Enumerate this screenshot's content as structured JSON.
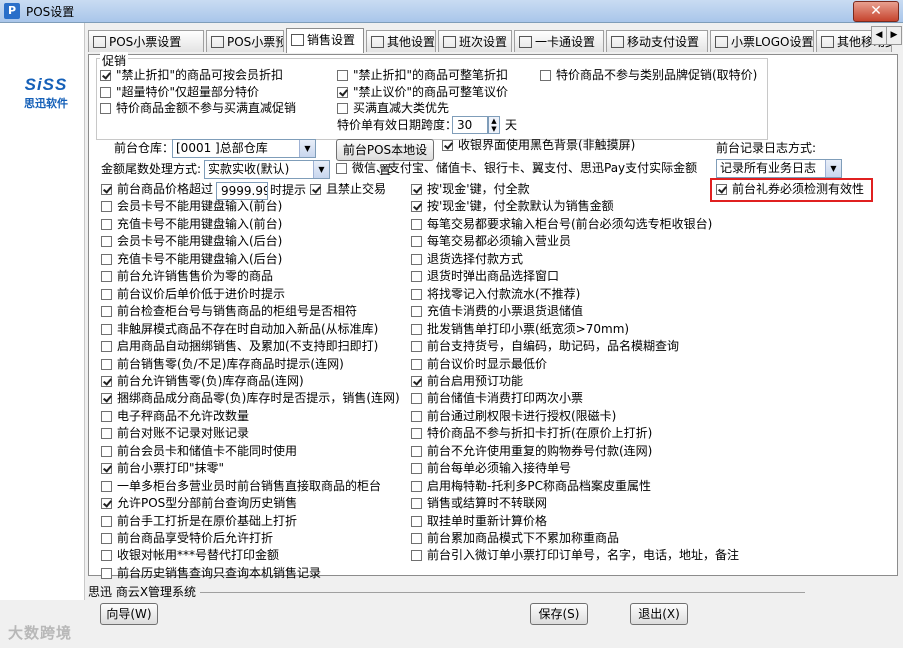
{
  "window": {
    "title": "POS设置",
    "close_label": "✕"
  },
  "logo": {
    "brand": "SiSS",
    "company": "思迅软件"
  },
  "tabs": [
    {
      "label": "POS小票设置",
      "icon": "receipt-icon"
    },
    {
      "label": "POS小票预览",
      "icon": "preview-icon"
    },
    {
      "label": "销售设置",
      "icon": "sales-icon",
      "active": true
    },
    {
      "label": "其他设置",
      "icon": "picture-icon"
    },
    {
      "label": "班次设置",
      "icon": "shift-icon"
    },
    {
      "label": "一卡通设置",
      "icon": "card-icon"
    },
    {
      "label": "移动支付设置",
      "icon": "mobile-pay-icon"
    },
    {
      "label": "小票LOGO设置",
      "icon": "logo-icon"
    },
    {
      "label": "其他移动支",
      "icon": "mobile-icon"
    }
  ],
  "promo": {
    "group_label": "促销",
    "items": [
      {
        "label": "\"禁止折扣\"的商品可按会员折扣",
        "checked": true
      },
      {
        "label": "\"超量特价\"仅超量部分特价",
        "checked": false
      },
      {
        "label": "特价商品金额不参与买满直减促销",
        "checked": false
      },
      {
        "label": "\"禁止折扣\"的商品可整笔折扣",
        "checked": false
      },
      {
        "label": "\"禁止议价\"的商品可整笔议价",
        "checked": true
      },
      {
        "label": "买满直减大类优先",
        "checked": false
      },
      {
        "label": "特价商品不参与类别品牌促销(取特价)",
        "checked": false
      }
    ],
    "days_label": "特价单有效日期跨度：",
    "days_value": "30",
    "days_unit": "天"
  },
  "settings": {
    "warehouse_label": "前台仓库：",
    "warehouse_value": "[0001  ]总部仓库",
    "pos_local_button": "前台POS本地设置",
    "black_bg": {
      "label": "收银界面使用黑色背景(非触摸屏)",
      "checked": true
    },
    "log_label": "前台记录日志方式:",
    "log_value": "记录所有业务日志",
    "rounding_label": "金额尾数处理方式:",
    "rounding_value": "实款实收(默认)",
    "pay_actual": {
      "label": "微信、支付宝、储值卡、银行卡、翼支付、思迅Pay支付实际金额",
      "checked": false
    },
    "gift_voucher": {
      "label": "前台礼券必须检测有效性",
      "checked": true
    },
    "price_limit_label": "前台商品价格超过",
    "price_limit_value": "9999.99",
    "price_limit_suffix": "时提示",
    "forbid_trade": {
      "label": "且禁止交易",
      "checked": true
    }
  },
  "left_column": [
    {
      "label": "前台商品价格超过",
      "checked": true
    },
    {
      "label": "会员卡号不能用键盘输入(前台)",
      "checked": false
    },
    {
      "label": "充值卡号不能用键盘输入(前台)",
      "checked": false
    },
    {
      "label": "会员卡号不能用键盘输入(后台)",
      "checked": false
    },
    {
      "label": "充值卡号不能用键盘输入(后台)",
      "checked": false
    },
    {
      "label": "前台允许销售售价为零的商品",
      "checked": false
    },
    {
      "label": "前台议价后单价低于进价时提示",
      "checked": false
    },
    {
      "label": "前台检查柜台号与销售商品的柜组号是否相符",
      "checked": false
    },
    {
      "label": "非触屏模式商品不存在时自动加入新品(从标准库)",
      "checked": false
    },
    {
      "label": "启用商品自动捆绑销售、及累加(不支持即扫即打)",
      "checked": false
    },
    {
      "label": "前台销售零(负/不足)库存商品时提示(连网)",
      "checked": false
    },
    {
      "label": "前台允许销售零(负)库存商品(连网)",
      "checked": true
    },
    {
      "label": "捆绑商品成分商品零(负)库存时是否提示，销售(连网)",
      "checked": true
    },
    {
      "label": "电子秤商品不允许改数量",
      "checked": false
    },
    {
      "label": "前台对账不记录对账记录",
      "checked": false
    },
    {
      "label": "前台会员卡和储值卡不能同时使用",
      "checked": false
    },
    {
      "label": "前台小票打印\"抹零\"",
      "checked": true
    },
    {
      "label": "一单多柜台多营业员时前台销售直接取商品的柜台",
      "checked": false
    },
    {
      "label": "允许POS型分部前台查询历史销售",
      "checked": true
    },
    {
      "label": "前台手工打折是在原价基础上打折",
      "checked": false
    },
    {
      "label": "前台商品享受特价后允许打折",
      "checked": false
    },
    {
      "label": "收银对帐用***号替代打印金额",
      "checked": false
    },
    {
      "label": "前台历史销售查询只查询本机销售记录",
      "checked": false
    }
  ],
  "right_column": [
    {
      "label": "按'现金'键，付全款",
      "checked": true
    },
    {
      "label": "按'现金'键，付全款默认为销售金额",
      "checked": true
    },
    {
      "label": "每笔交易都要求输入柜台号(前台必须勾选专柜收银台)",
      "checked": false
    },
    {
      "label": "每笔交易都必须输入营业员",
      "checked": false
    },
    {
      "label": "退货选择付款方式",
      "checked": false
    },
    {
      "label": "退货时弹出商品选择窗口",
      "checked": false
    },
    {
      "label": "将找零记入付款流水(不推荐)",
      "checked": false
    },
    {
      "label": "充值卡消费的小票退货退储值",
      "checked": false
    },
    {
      "label": "批发销售单打印小票(纸宽须>70mm)",
      "checked": false
    },
    {
      "label": "前台支持货号，自编码，助记码，品名模糊查询",
      "checked": false
    },
    {
      "label": "前台议价时显示最低价",
      "checked": false
    },
    {
      "label": "前台启用预订功能",
      "checked": true
    },
    {
      "label": "前台储值卡消费打印两次小票",
      "checked": false
    },
    {
      "label": "前台通过刷权限卡进行授权(限磁卡)",
      "checked": false
    },
    {
      "label": "特价商品不参与折扣卡打折(在原价上打折)",
      "checked": false
    },
    {
      "label": "前台不允许使用重复的购物券号付款(连网)",
      "checked": false
    },
    {
      "label": "前台每单必须输入接待单号",
      "checked": false
    },
    {
      "label": "启用梅特勒-托利多PC称商品档案皮重属性",
      "checked": false
    },
    {
      "label": "销售或结算时不转联网",
      "checked": false
    },
    {
      "label": "取挂单时重新计算价格",
      "checked": false
    },
    {
      "label": "前台累加商品模式下不累加称重商品",
      "checked": false
    },
    {
      "label": "前台引入微订单小票打印订单号，名字，电话，地址，备注",
      "checked": false
    }
  ],
  "footer": {
    "company_line": "思迅 商云X管理系统",
    "wizard_button": "向导(W)",
    "save_button": "保存(S)",
    "exit_button": "退出(X)",
    "watermark": "大数跨境"
  }
}
